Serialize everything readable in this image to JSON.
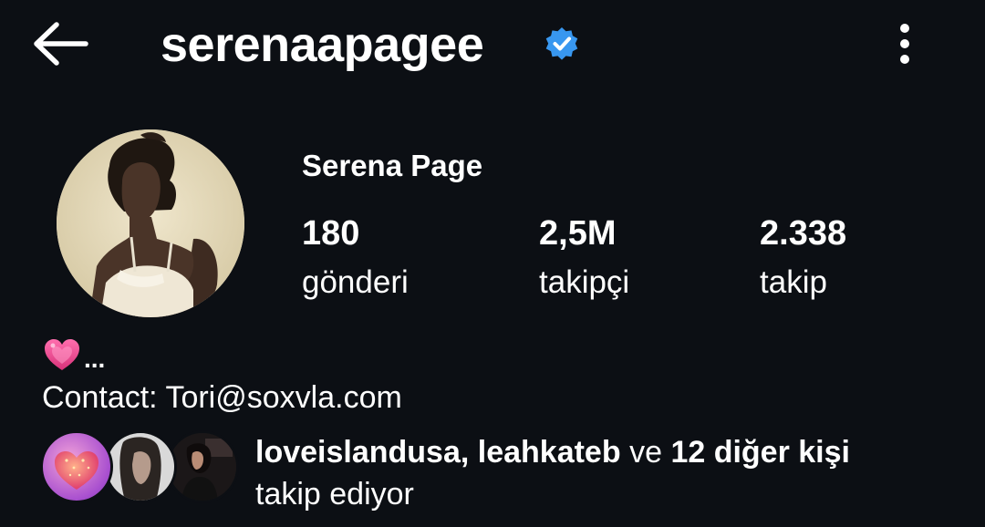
{
  "header": {
    "username": "serenaapagee",
    "back_icon": "arrow-left-icon",
    "verified_icon": "verified-badge-icon",
    "more_icon": "more-vertical-icon"
  },
  "profile": {
    "display_name": "Serena Page",
    "stats": {
      "posts_value": "180",
      "posts_label": "gönderi",
      "followers_value": "2,5M",
      "followers_label": "takipçi",
      "following_value": "2.338",
      "following_label": "takip"
    },
    "bio": {
      "line1_emoji": "heart-emoji",
      "line1_text": "...",
      "contact": "Contact: Tori@soxvla.com"
    },
    "followed_by": {
      "names": "loveislandusa, leahkateb",
      "connector": " ve ",
      "others": "12 diğer kişi",
      "suffix": "takip ediyor"
    }
  },
  "colors": {
    "background": "#0c0f14",
    "text": "#ffffff",
    "verified_blue": "#3897f0",
    "heart_pink": "#e8478b"
  }
}
